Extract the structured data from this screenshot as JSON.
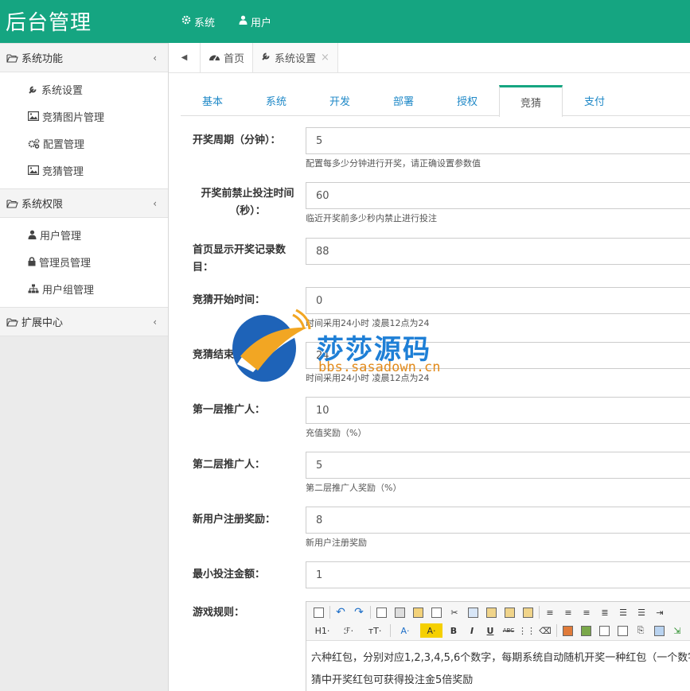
{
  "header": {
    "logo": "后台管理",
    "nav": [
      {
        "label": "系统",
        "icon": "gear-icon"
      },
      {
        "label": "用户",
        "icon": "user-icon"
      }
    ]
  },
  "sidebar": {
    "groups": [
      {
        "label": "系统功能",
        "items": [
          {
            "label": "系统设置",
            "icon": "wrench-icon"
          },
          {
            "label": "竞猜图片管理",
            "icon": "image-icon"
          },
          {
            "label": "配置管理",
            "icon": "cogs-icon"
          },
          {
            "label": "竞猜管理",
            "icon": "image-icon"
          }
        ]
      },
      {
        "label": "系统权限",
        "items": [
          {
            "label": "用户管理",
            "icon": "user-icon"
          },
          {
            "label": "管理员管理",
            "icon": "lock-icon"
          },
          {
            "label": "用户组管理",
            "icon": "sitemap-icon"
          }
        ]
      },
      {
        "label": "扩展中心",
        "items": []
      }
    ]
  },
  "tabbar": {
    "tabs": [
      {
        "label": "首页",
        "icon": "dashboard-icon"
      },
      {
        "label": "系统设置",
        "icon": "wrench-icon",
        "close": "×"
      }
    ]
  },
  "subtabs": [
    "基本",
    "系统",
    "开发",
    "部署",
    "授权",
    "竞猜",
    "支付"
  ],
  "active_subtab": "竞猜",
  "form": {
    "fields": [
      {
        "label": "开奖周期（分钟）：",
        "value": "5",
        "help": "配置每多少分钟进行开奖，请正确设置参数值"
      },
      {
        "label": "开奖前禁止投注时间（秒）：",
        "value": "60",
        "help": "临近开奖前多少秒内禁止进行投注"
      },
      {
        "label": "首页显示开奖记录数目：",
        "value": "88",
        "help": ""
      },
      {
        "label": "竞猜开始时间：",
        "value": "0",
        "help": "时间采用24小时 凌晨12点为24"
      },
      {
        "label": "竞猜结束时间：",
        "value": "24",
        "help": "时间采用24小时 凌晨12点为24"
      },
      {
        "label": "第一层推广人：",
        "value": "10",
        "help": "充值奖励（%）"
      },
      {
        "label": "第二层推广人：",
        "value": "5",
        "help": "第二层推广人奖励（%）"
      },
      {
        "label": "新用户注册奖励：",
        "value": "8",
        "help": "新用户注册奖励"
      },
      {
        "label": "最小投注金额：",
        "value": "1",
        "help": ""
      }
    ],
    "rules_label": "游戏规则：",
    "rules_lines": [
      "六种红包，分别对应1,2,3,4,5,6个数字，每期系统自动随机开奖一种红包（一个数字）",
      "猜中开奖红包可获得投注金5倍奖励"
    ]
  },
  "editor_toolbar": {
    "heading": "H1·",
    "font": "ℱ·",
    "size": "тT·",
    "color": "A·",
    "bg": "A·",
    "bold": "B",
    "italic": "I",
    "underline": "U",
    "strike": "ABC"
  },
  "watermark": {
    "title": "莎莎源码",
    "url": "bbs.sasadown.cn"
  }
}
